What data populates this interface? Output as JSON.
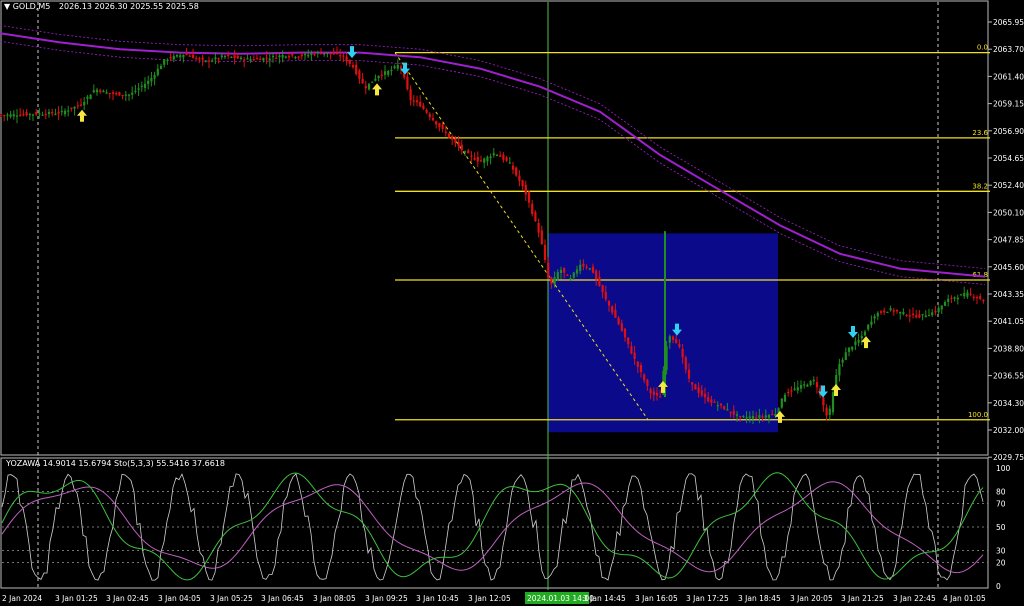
{
  "header": {
    "symbol": "GOLD,M5",
    "ohlc": "2026.13 2026.30 2025.55 2025.58",
    "menu_glyph": "▼"
  },
  "subwindow": {
    "label": "YOZAWA 14.9014 15.6794  Sto(5,3,3) 55.5416 37.6618",
    "levels": [
      "100",
      "80",
      "70",
      "50",
      "30",
      "20",
      "0"
    ]
  },
  "price_axis_labels": [
    "2065.95",
    "2063.70",
    "2061.40",
    "2059.15",
    "2056.90",
    "2054.65",
    "2052.40",
    "2050.10",
    "2047.85",
    "2045.60",
    "2043.35",
    "2041.05",
    "2038.80",
    "2036.55",
    "2034.30",
    "2032.00",
    "2029.75"
  ],
  "time_axis_labels": [
    "2 Jan 2024",
    "3 Jan 01:25",
    "3 Jan 02:45",
    "3 Jan 04:05",
    "3 Jan 05:25",
    "3 Jan 06:45",
    "3 Jan 08:05",
    "3 Jan 09:25",
    "3 Jan 10:45",
    "3 Jan 12:05",
    "2024.01.03 14:00",
    "3 Jan 14:45",
    "3 Jan 16:05",
    "3 Jan 17:25",
    "3 Jan 18:45",
    "3 Jan 20:05",
    "3 Jan 21:25",
    "3 Jan 22:45",
    "4 Jan 01:05"
  ],
  "fibo_levels": [
    {
      "label": "0.0",
      "price": 2064.6
    },
    {
      "label": "23.6",
      "price": 2057.1
    },
    {
      "label": "38.2",
      "price": 2052.4
    },
    {
      "label": "61.8",
      "price": 2044.6
    },
    {
      "label": "100.0",
      "price": 2032.3
    }
  ],
  "colors": {
    "bull": "#1f8f1f",
    "bear": "#e01010",
    "ma": "#a020d0",
    "fibo": "#f0e020",
    "box": "#0a0a8a",
    "grid": "#cccccc",
    "crosshair": "#4fbf4f",
    "up_arrow": "#f5e642",
    "down_arrow": "#2fd0f0",
    "stoch_main": "#3fbf3f",
    "stoch_signal": "#c060c0",
    "yozawa": "#d0d0d0"
  },
  "chart_data": {
    "type": "candlestick",
    "symbol": "GOLD",
    "timeframe": "M5",
    "ylim": [
      2029.2,
      2068.0
    ],
    "close_path": [
      [
        0,
        2059.1
      ],
      [
        30,
        2059.2
      ],
      [
        60,
        2059.3
      ],
      [
        80,
        2060.0
      ],
      [
        95,
        2061.4
      ],
      [
        110,
        2061.0
      ],
      [
        130,
        2060.9
      ],
      [
        150,
        2062.2
      ],
      [
        165,
        2064.0
      ],
      [
        185,
        2064.5
      ],
      [
        205,
        2063.8
      ],
      [
        225,
        2064.3
      ],
      [
        245,
        2064.0
      ],
      [
        265,
        2064.1
      ],
      [
        285,
        2064.4
      ],
      [
        300,
        2064.3
      ],
      [
        320,
        2064.6
      ],
      [
        340,
        2064.4
      ],
      [
        352,
        2063.5
      ],
      [
        365,
        2061.5
      ],
      [
        378,
        2062.6
      ],
      [
        390,
        2063.0
      ],
      [
        400,
        2063.6
      ],
      [
        410,
        2060.5
      ],
      [
        420,
        2060.0
      ],
      [
        435,
        2058.5
      ],
      [
        450,
        2057.1
      ],
      [
        465,
        2055.8
      ],
      [
        480,
        2055.0
      ],
      [
        495,
        2055.8
      ],
      [
        510,
        2054.8
      ],
      [
        525,
        2052.4
      ],
      [
        540,
        2048.5
      ],
      [
        550,
        2044.0
      ],
      [
        560,
        2045.6
      ],
      [
        570,
        2044.6
      ],
      [
        580,
        2046.0
      ],
      [
        592,
        2045.5
      ],
      [
        605,
        2043.0
      ],
      [
        620,
        2040.5
      ],
      [
        635,
        2037.5
      ],
      [
        650,
        2034.7
      ],
      [
        660,
        2034.2
      ],
      [
        668,
        2039.9
      ],
      [
        678,
        2039.0
      ],
      [
        690,
        2035.5
      ],
      [
        705,
        2034.2
      ],
      [
        720,
        2033.5
      ],
      [
        740,
        2032.5
      ],
      [
        760,
        2032.6
      ],
      [
        775,
        2032.8
      ],
      [
        785,
        2034.6
      ],
      [
        800,
        2035.2
      ],
      [
        815,
        2035.8
      ],
      [
        828,
        2032.3
      ],
      [
        838,
        2037.0
      ],
      [
        848,
        2038.5
      ],
      [
        860,
        2039.4
      ],
      [
        875,
        2041.6
      ],
      [
        890,
        2042.0
      ],
      [
        905,
        2041.6
      ],
      [
        920,
        2041.4
      ],
      [
        935,
        2041.8
      ],
      [
        950,
        2043.0
      ],
      [
        968,
        2043.4
      ],
      [
        985,
        2042.8
      ]
    ],
    "moving_average": [
      [
        0,
        2066.3
      ],
      [
        60,
        2065.5
      ],
      [
        120,
        2064.9
      ],
      [
        180,
        2064.6
      ],
      [
        240,
        2064.5
      ],
      [
        300,
        2064.6
      ],
      [
        360,
        2064.6
      ],
      [
        420,
        2064.2
      ],
      [
        480,
        2063.2
      ],
      [
        540,
        2061.6
      ],
      [
        600,
        2059.4
      ],
      [
        660,
        2055.6
      ],
      [
        720,
        2052.5
      ],
      [
        780,
        2049.4
      ],
      [
        840,
        2046.9
      ],
      [
        900,
        2045.6
      ],
      [
        985,
        2044.9
      ]
    ],
    "up_arrow_times": [
      82,
      377,
      663,
      780,
      836,
      866
    ],
    "down_arrow_times": [
      352,
      405,
      677,
      823,
      853
    ],
    "fibo_time_range": [
      395,
      990
    ],
    "fibo_trendline": [
      [
        395,
        2064.6
      ],
      [
        648,
        2032.3
      ]
    ],
    "range_box": {
      "t1": 548,
      "t2": 778,
      "p1": 2048.7,
      "p2": 2031.2
    },
    "indicator": {
      "name": "Sto(5,3,3)",
      "main": 55.5416,
      "signal": 37.6618,
      "yozawa": [
        14.9014,
        15.6794
      ],
      "levels": [
        100,
        80,
        70,
        50,
        30,
        20,
        0
      ]
    }
  }
}
